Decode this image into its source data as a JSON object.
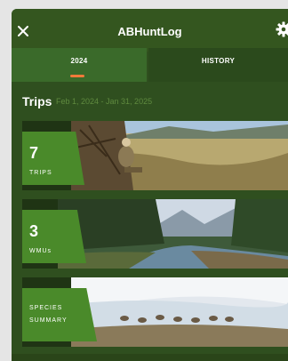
{
  "app": {
    "title": "ABHuntLog"
  },
  "tabs": [
    {
      "label": "2024",
      "active": true
    },
    {
      "label": "HISTORY",
      "active": false
    }
  ],
  "trips_section": {
    "title": "Trips",
    "date_range": "Feb 1, 2024 - Jan 31, 2025"
  },
  "cards": {
    "trips": {
      "count": "7",
      "label": "TRIPS"
    },
    "wmus": {
      "count": "3",
      "label": "WMUs"
    },
    "species": {
      "label_line1": "SPECIES",
      "label_line2": "SUMMARY"
    }
  },
  "icons": {
    "close": "close-icon",
    "settings": "gear-icon"
  },
  "colors": {
    "background": "#2f4f1f",
    "badge": "#4a8a2a",
    "tab_indicator": "#f07a3a",
    "date_range_text": "#5f8a3f"
  }
}
